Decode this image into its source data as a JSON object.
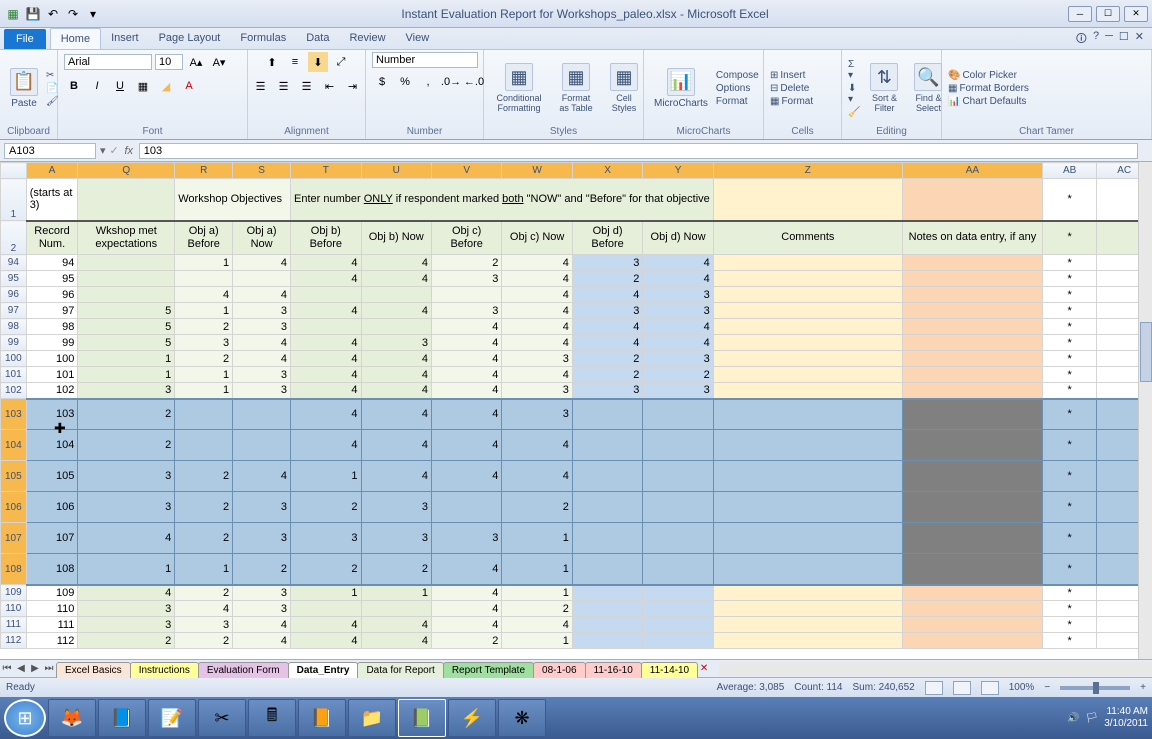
{
  "titlebar": {
    "title": "Instant Evaluation Report for Workshops_paleo.xlsx - Microsoft Excel"
  },
  "tabs": {
    "file": "File",
    "list": [
      "Home",
      "Insert",
      "Page Layout",
      "Formulas",
      "Data",
      "Review",
      "View"
    ],
    "active": 0
  },
  "ribbon": {
    "clipboard": {
      "label": "Clipboard",
      "paste": "Paste"
    },
    "font": {
      "label": "Font",
      "name": "Arial",
      "size": "10"
    },
    "alignment": {
      "label": "Alignment"
    },
    "number": {
      "label": "Number",
      "format": "Number"
    },
    "styles": {
      "label": "Styles",
      "cond": "Conditional Formatting",
      "tbl": "Format as Table",
      "cell": "Cell Styles"
    },
    "micro": {
      "label": "MicroCharts",
      "compose": "Compose",
      "options": "Options",
      "format": "Format"
    },
    "cells": {
      "label": "Cells",
      "insert": "Insert",
      "delete": "Delete",
      "format": "Format"
    },
    "editing": {
      "label": "Editing",
      "sort": "Sort & Filter",
      "find": "Find & Select"
    },
    "tamer": {
      "label": "Chart Tamer",
      "pick": "Color Picker",
      "bord": "Format Borders",
      "def": "Chart Defaults"
    }
  },
  "formula": {
    "name": "A103",
    "value": "103"
  },
  "columns": [
    "A",
    "Q",
    "R",
    "S",
    "T",
    "U",
    "V",
    "W",
    "X",
    "Y",
    "Z",
    "AA",
    "AB",
    "AC"
  ],
  "row1": {
    "starts": "(starts at 3)",
    "wobj": "Workshop Objectives",
    "enter": "Enter number ONLY if respondent marked both \"NOW\" and \"Before\" for that objective"
  },
  "row2": {
    "a": "Record Num.",
    "q": "Wkshop met expectations",
    "r": "Obj a) Before",
    "s": "Obj a) Now",
    "t": "Obj b) Before",
    "u": "Obj b) Now",
    "v": "Obj c) Before",
    "w": "Obj c) Now",
    "x": "Obj d) Before",
    "y": "Obj d) Now",
    "z": "Comments",
    "aa": "Notes on data entry, if any"
  },
  "rows": [
    {
      "rn": 94,
      "a": 94,
      "q": "",
      "r": 1,
      "s": 4,
      "t": 4,
      "u": 4,
      "v": 2,
      "w": 4,
      "x": 3,
      "y": 4,
      "z": "",
      "aa": "",
      "ab": "*"
    },
    {
      "rn": 95,
      "a": 95,
      "q": "",
      "r": "",
      "s": "",
      "t": 4,
      "u": 4,
      "v": 3,
      "w": 4,
      "x": 2,
      "y": 4,
      "z": "",
      "aa": "",
      "ab": "*"
    },
    {
      "rn": 96,
      "a": 96,
      "q": "",
      "r": 4,
      "s": 4,
      "t": "",
      "u": "",
      "v": "",
      "w": 4,
      "x": 4,
      "y": 3,
      "z": "",
      "aa": "",
      "ab": "*"
    },
    {
      "rn": 97,
      "a": 97,
      "q": 5,
      "r": 1,
      "s": 3,
      "t": 4,
      "u": 4,
      "v": 3,
      "w": 4,
      "x": 3,
      "y": 3,
      "z": "",
      "aa": "",
      "ab": "*"
    },
    {
      "rn": 98,
      "a": 98,
      "q": 5,
      "r": 2,
      "s": 3,
      "t": "",
      "u": "",
      "v": 4,
      "w": 4,
      "x": 4,
      "y": 4,
      "z": "",
      "aa": "",
      "ab": "*"
    },
    {
      "rn": 99,
      "a": 99,
      "q": 5,
      "r": 3,
      "s": 4,
      "t": 4,
      "u": 3,
      "v": 4,
      "w": 4,
      "x": 4,
      "y": 4,
      "z": "",
      "aa": "",
      "ab": "*"
    },
    {
      "rn": 100,
      "a": 100,
      "q": 1,
      "r": 2,
      "s": 4,
      "t": 4,
      "u": 4,
      "v": 4,
      "w": 3,
      "x": 2,
      "y": 3,
      "z": "",
      "aa": "",
      "ab": "*"
    },
    {
      "rn": 101,
      "a": 101,
      "q": 1,
      "r": 1,
      "s": 3,
      "t": 4,
      "u": 4,
      "v": 4,
      "w": 4,
      "x": 2,
      "y": 2,
      "z": "",
      "aa": "",
      "ab": "*"
    },
    {
      "rn": 102,
      "a": 102,
      "q": 3,
      "r": 1,
      "s": 3,
      "t": 4,
      "u": 4,
      "v": 4,
      "w": 3,
      "x": 3,
      "y": 3,
      "z": "",
      "aa": "",
      "ab": "*"
    },
    {
      "rn": 103,
      "a": 103,
      "q": 2,
      "r": "",
      "s": "",
      "t": 4,
      "u": 4,
      "v": 4,
      "w": 3,
      "x": "",
      "y": "",
      "z": "",
      "aa": "",
      "ab": "*",
      "sel": true,
      "top": true
    },
    {
      "rn": 104,
      "a": 104,
      "q": 2,
      "r": "",
      "s": "",
      "t": 4,
      "u": 4,
      "v": 4,
      "w": 4,
      "x": "",
      "y": "",
      "z": "",
      "aa": "",
      "ab": "*",
      "sel": true
    },
    {
      "rn": 105,
      "a": 105,
      "q": 3,
      "r": 2,
      "s": 4,
      "t": 1,
      "u": 4,
      "v": 4,
      "w": 4,
      "x": "",
      "y": "",
      "z": "",
      "aa": "",
      "ab": "*",
      "sel": true
    },
    {
      "rn": 106,
      "a": 106,
      "q": 3,
      "r": 2,
      "s": 3,
      "t": 2,
      "u": 3,
      "v": "",
      "w": 2,
      "x": "",
      "y": "",
      "z": "",
      "aa": "",
      "ab": "*",
      "sel": true
    },
    {
      "rn": 107,
      "a": 107,
      "q": 4,
      "r": 2,
      "s": 3,
      "t": 3,
      "u": 3,
      "v": 3,
      "w": 1,
      "x": "",
      "y": "",
      "z": "",
      "aa": "",
      "ab": "*",
      "sel": true
    },
    {
      "rn": 108,
      "a": 108,
      "q": 1,
      "r": 1,
      "s": 2,
      "t": 2,
      "u": 2,
      "v": 4,
      "w": 1,
      "x": "",
      "y": "",
      "z": "",
      "aa": "",
      "ab": "*",
      "sel": true,
      "bot": true
    },
    {
      "rn": 109,
      "a": 109,
      "q": 4,
      "r": 2,
      "s": 3,
      "t": 1,
      "u": 1,
      "v": 4,
      "w": 1,
      "x": "",
      "y": "",
      "z": "",
      "aa": "",
      "ab": "*"
    },
    {
      "rn": 110,
      "a": 110,
      "q": 3,
      "r": 4,
      "s": 3,
      "t": "",
      "u": "",
      "v": 4,
      "w": 2,
      "x": "",
      "y": "",
      "z": "",
      "aa": "",
      "ab": "*"
    },
    {
      "rn": 111,
      "a": 111,
      "q": 3,
      "r": 3,
      "s": 4,
      "t": 4,
      "u": 4,
      "v": 4,
      "w": 4,
      "x": "",
      "y": "",
      "z": "",
      "aa": "",
      "ab": "*"
    },
    {
      "rn": 112,
      "a": 112,
      "q": 2,
      "r": 2,
      "s": 4,
      "t": 4,
      "u": 4,
      "v": 2,
      "w": 1,
      "x": "",
      "y": "",
      "z": "",
      "aa": "",
      "ab": "*"
    }
  ],
  "sheets": [
    {
      "name": "Excel Basics",
      "color": "#fbe5d6"
    },
    {
      "name": "Instructions",
      "color": "#ffff99"
    },
    {
      "name": "Evaluation Form",
      "color": "#e6c3e6"
    },
    {
      "name": "Data_Entry",
      "color": "#ffffff",
      "active": true
    },
    {
      "name": "Data for Report",
      "color": "#e6efda"
    },
    {
      "name": "Report Template",
      "color": "#9fdf9f"
    },
    {
      "name": "08-1-06",
      "color": "#ffcccc"
    },
    {
      "name": "11-16-10",
      "color": "#ffcccc"
    },
    {
      "name": "11-14-10",
      "color": "#ffff99"
    }
  ],
  "status": {
    "ready": "Ready",
    "avg": "Average: 3,085",
    "count": "Count: 114",
    "sum": "Sum: 240,652",
    "zoom": "100%"
  },
  "clock": {
    "time": "11:40 AM",
    "date": "3/10/2011"
  }
}
